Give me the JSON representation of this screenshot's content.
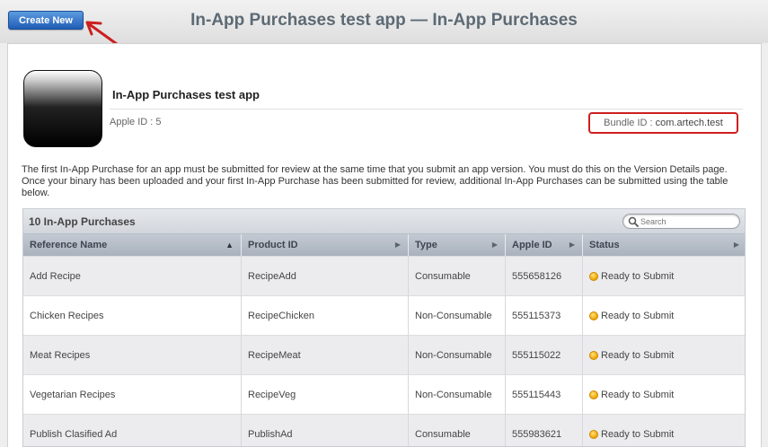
{
  "header": {
    "create_label": "Create New",
    "title": "In-App Purchases test app — In-App Purchases"
  },
  "app": {
    "name": "In-App Purchases test app",
    "apple_id_label": "Apple ID :",
    "apple_id": "5",
    "bundle_id_label": "Bundle ID :",
    "bundle_id": "com.artech.test"
  },
  "note": "The first In-App Purchase for an app must be submitted for review at the same time that you submit an app version. You must do this on the Version Details page. Once your binary has been uploaded and your first In-App Purchase has been submitted for review, additional In-App Purchases can be submitted using the table below.",
  "table": {
    "caption": "10 In-App Purchases",
    "search_placeholder": "Search",
    "columns": [
      "Reference Name",
      "Product ID",
      "Type",
      "Apple ID",
      "Status"
    ],
    "rows": [
      {
        "reference_name": "Add Recipe",
        "product_id": "RecipeAdd",
        "type": "Consumable",
        "apple_id": "555658126",
        "status": "Ready to Submit"
      },
      {
        "reference_name": "Chicken Recipes",
        "product_id": "RecipeChicken",
        "type": "Non-Consumable",
        "apple_id": "555115373",
        "status": "Ready to Submit"
      },
      {
        "reference_name": "Meat Recipes",
        "product_id": "RecipeMeat",
        "type": "Non-Consumable",
        "apple_id": "555115022",
        "status": "Ready to Submit"
      },
      {
        "reference_name": "Vegetarian Recipes",
        "product_id": "RecipeVeg",
        "type": "Non-Consumable",
        "apple_id": "555115443",
        "status": "Ready to Submit"
      },
      {
        "reference_name": "Publish Clasified Ad",
        "product_id": "PublishAd",
        "type": "Consumable",
        "apple_id": "555983621",
        "status": "Ready to Submit"
      }
    ]
  },
  "colors": {
    "annotation_red": "#cc1f1f",
    "button_blue": "#1f5db5",
    "status_yellow": "#f0a500"
  },
  "icons": {
    "search": "search-icon",
    "status": "status-dot-icon",
    "sort": "sort-arrow-icon"
  }
}
